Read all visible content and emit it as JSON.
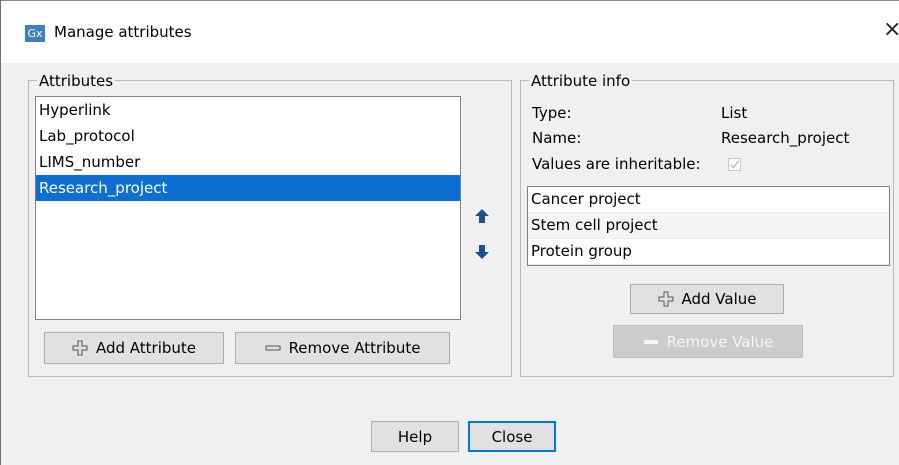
{
  "window": {
    "app_icon_text": "Gx",
    "title": "Manage attributes",
    "close_glyph": "×"
  },
  "attributes": {
    "group_label": "Attributes",
    "items": [
      {
        "label": "Hyperlink",
        "selected": false
      },
      {
        "label": "Lab_protocol",
        "selected": false
      },
      {
        "label": "LIMS_number",
        "selected": false
      },
      {
        "label": "Research_project",
        "selected": true
      }
    ],
    "move_up_icon": "arrow-up-icon",
    "move_down_icon": "arrow-down-icon",
    "add_button": "Add Attribute",
    "remove_button": "Remove Attribute"
  },
  "attribute_info": {
    "group_label": "Attribute info",
    "type_label": "Type:",
    "type_value": "List",
    "name_label": "Name:",
    "name_value": "Research_project",
    "inheritable_label": "Values are inheritable:",
    "inheritable_checked": true,
    "values": [
      "Cancer project",
      "Stem cell project",
      "Protein group"
    ],
    "add_value_button": "Add Value",
    "remove_value_button": "Remove Value"
  },
  "footer": {
    "help_button": "Help",
    "close_button": "Close"
  },
  "colors": {
    "selection": "#0c6fd1",
    "arrow": "#1f4f8f",
    "dialog_bg": "#f0f0f0"
  }
}
